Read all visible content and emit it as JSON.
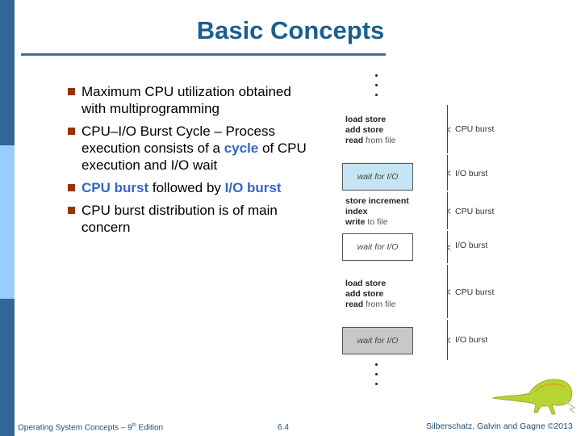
{
  "slide": {
    "title": "Basic Concepts",
    "bullets": [
      {
        "parts": [
          {
            "text": "Maximum CPU utilization obtained with multiprogramming",
            "hl": false
          }
        ]
      },
      {
        "parts": [
          {
            "text": "CPU–I/O Burst Cycle – Process execution consists of a ",
            "hl": false
          },
          {
            "text": "cycle",
            "hl": true
          },
          {
            "text": " of CPU execution and I/O wait",
            "hl": false
          }
        ]
      },
      {
        "parts": [
          {
            "text": "CPU burst",
            "hl": true
          },
          {
            "text": " followed by ",
            "hl": false
          },
          {
            "text": "I/O burst",
            "hl": true
          }
        ]
      },
      {
        "parts": [
          {
            "text": "CPU burst distribution is of main concern",
            "hl": false
          }
        ]
      }
    ]
  },
  "diagram": {
    "cpu_blocks": [
      {
        "lines": [
          {
            "bold": "load store",
            "rest": ""
          },
          {
            "bold": "add store",
            "rest": ""
          },
          {
            "bold": "read",
            "rest": " from file"
          }
        ]
      },
      {
        "lines": [
          {
            "bold": "store increment",
            "rest": ""
          },
          {
            "bold": "index",
            "rest": ""
          },
          {
            "bold": "write",
            "rest": " to file"
          }
        ]
      },
      {
        "lines": [
          {
            "bold": "load store",
            "rest": ""
          },
          {
            "bold": "add store",
            "rest": ""
          },
          {
            "bold": "read",
            "rest": " from file"
          }
        ]
      }
    ],
    "wait_boxes": [
      {
        "label": "wait for I/O",
        "color": "#c5e5f5"
      },
      {
        "label": "wait for I/O",
        "color": "#ffffff"
      },
      {
        "label": "wait for I/O",
        "color": "#c8c8c8"
      }
    ],
    "burst_labels": [
      "CPU burst",
      "I/O burst",
      "CPU burst",
      "I/O burst",
      "CPU burst",
      "I/O burst"
    ]
  },
  "footer": {
    "book": "Operating System Concepts – 9",
    "book_sup": "th",
    "book_suffix": " Edition",
    "page": "6.4",
    "copyright": "Silberschatz, Galvin and Gagne ©2013"
  },
  "colors": {
    "sidebar_dark": "#336699",
    "sidebar_light": "#99ccff",
    "title": "#1b5f8f",
    "bullet": "#993300",
    "highlight": "#3366cc"
  }
}
